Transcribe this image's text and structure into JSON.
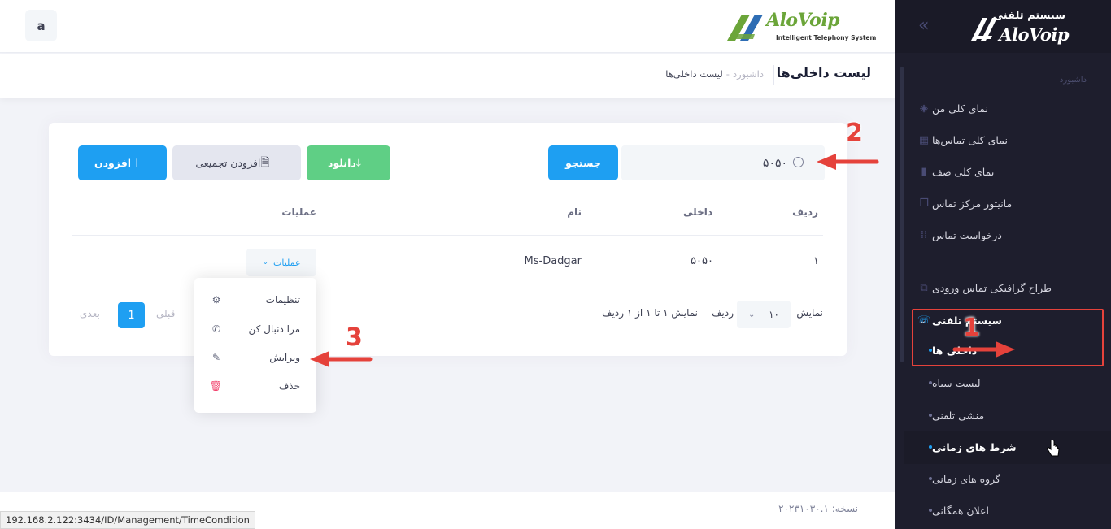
{
  "topbar": {
    "avatar_letter": "a",
    "brand_name": "AloVoip",
    "brand_tagline": "Intelligent Telephony System"
  },
  "sidebar": {
    "logo_subtitle": "سیستم تلفنی",
    "logo_name": "AloVoip",
    "section_label": "داشبورد",
    "items": [
      {
        "label": "نمای کلی من",
        "icon": "dashboard-icon"
      },
      {
        "label": "نمای کلی تماس‌ها",
        "icon": "calls-icon"
      },
      {
        "label": "نمای کلی صف",
        "icon": "queue-icon"
      },
      {
        "label": "مانیتور مرکز تماس",
        "icon": "monitor-icon"
      },
      {
        "label": "درخواست تماس",
        "icon": "grid-icon"
      },
      {
        "label": "طراح گرافیکی تماس ورودی",
        "icon": "designer-icon"
      }
    ],
    "telephony": {
      "label": "سیستم تلفنی",
      "submenu": [
        "داخلی ها",
        "لیست سیاه",
        "منشی تلفنی",
        "شرط های زمانی",
        "گروه های زمانی",
        "اعلان همگانی"
      ]
    }
  },
  "subheader": {
    "title": "لیست داخلی‌ها",
    "breadcrumb_home": "داشبورد",
    "breadcrumb_sep": "-",
    "breadcrumb_current": "لیست داخلی‌ها"
  },
  "toolbar": {
    "search_value": "۵۰۵۰",
    "search_button": "جستجو",
    "download_button": "دانلود",
    "bulk_add_button": "افزودن تجمیعی",
    "add_button": "افزودن"
  },
  "table": {
    "headers": [
      "ردیف",
      "داخلی",
      "نام",
      "عملیات"
    ],
    "rows": [
      {
        "index": "۱",
        "extension": "۵۰۵۰",
        "name": "Ms-Dadgar",
        "actions_label": "عملیات"
      }
    ]
  },
  "actions_menu": [
    {
      "label": "تنظیمات",
      "icon": "gear-icon"
    },
    {
      "label": "مرا دنبال کن",
      "icon": "phone-forward-icon"
    },
    {
      "label": "ویرایش",
      "icon": "edit-icon"
    },
    {
      "label": "حذف",
      "icon": "trash-icon"
    }
  ],
  "pagination": {
    "show_label": "نمایش",
    "rows_per_page": "۱۰",
    "rows_label": "ردیف",
    "summary": "نمایش ۱ تا ۱ از ۱ ردیف",
    "prev": "قبلی",
    "current_page": "1",
    "next": "بعدی"
  },
  "footer": {
    "version": "نسخه: ۲۰۲۳۱۰۳۰.۱",
    "status_url": "192.168.2.122:3434/ID/Management/TimeCondition"
  },
  "annotations": [
    "1",
    "2",
    "3"
  ],
  "colors": {
    "primary": "#1e9ff2",
    "success": "#5fcf85",
    "danger": "#f1416c",
    "sidebar_bg": "#1e1e2d",
    "annotation_red": "#e5423b"
  }
}
